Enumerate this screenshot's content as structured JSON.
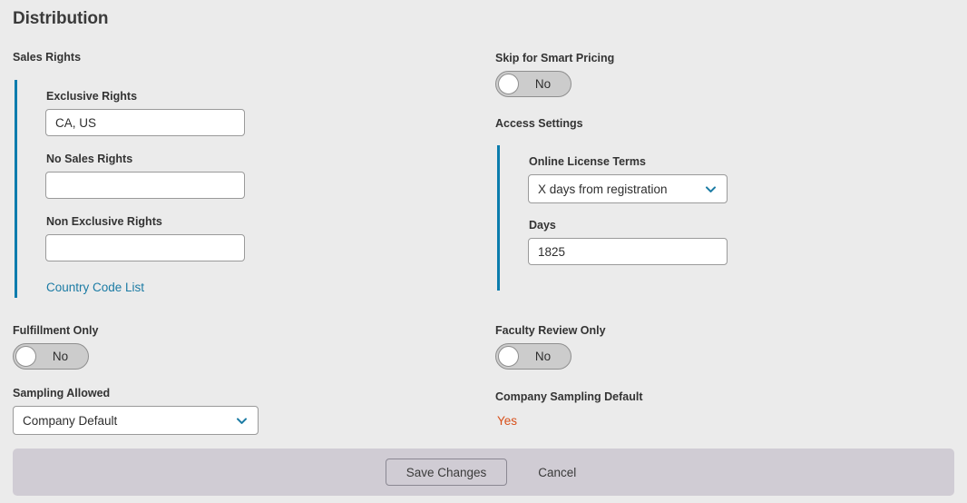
{
  "page": {
    "title": "Distribution"
  },
  "left_column": {
    "sales_rights": {
      "section_label": "Sales Rights",
      "fields": [
        {
          "label": "Exclusive Rights",
          "value": "CA, US"
        },
        {
          "label": "No Sales Rights",
          "value": ""
        },
        {
          "label": "Non Exclusive Rights",
          "value": ""
        }
      ],
      "link_label": "Country Code List"
    },
    "fulfillment_only": {
      "label": "Fulfillment Only",
      "toggle_value": "No"
    },
    "sampling_allowed": {
      "label": "Sampling Allowed",
      "selected": "Company Default",
      "chevron_icon": "chevron-down-icon"
    }
  },
  "right_column": {
    "skip_smart_pricing": {
      "label": "Skip for Smart Pricing",
      "toggle_value": "No"
    },
    "access_settings": {
      "section_label": "Access Settings",
      "online_license_terms": {
        "label": "Online License Terms",
        "selected": "X days from registration",
        "chevron_icon": "chevron-down-icon"
      },
      "days": {
        "label": "Days",
        "value": "1825"
      }
    },
    "faculty_review_only": {
      "label": "Faculty Review Only",
      "toggle_value": "No"
    },
    "company_sampling_default": {
      "label": "Company Sampling Default",
      "value": "Yes"
    }
  },
  "footer": {
    "save_label": "Save Changes",
    "cancel_label": "Cancel"
  },
  "colors": {
    "accent_blue": "#0b7cad",
    "link_blue": "#1b7ba4",
    "value_orange": "#d8501a",
    "page_background": "#ebebeb",
    "footer_background": "#d0ccd4"
  }
}
